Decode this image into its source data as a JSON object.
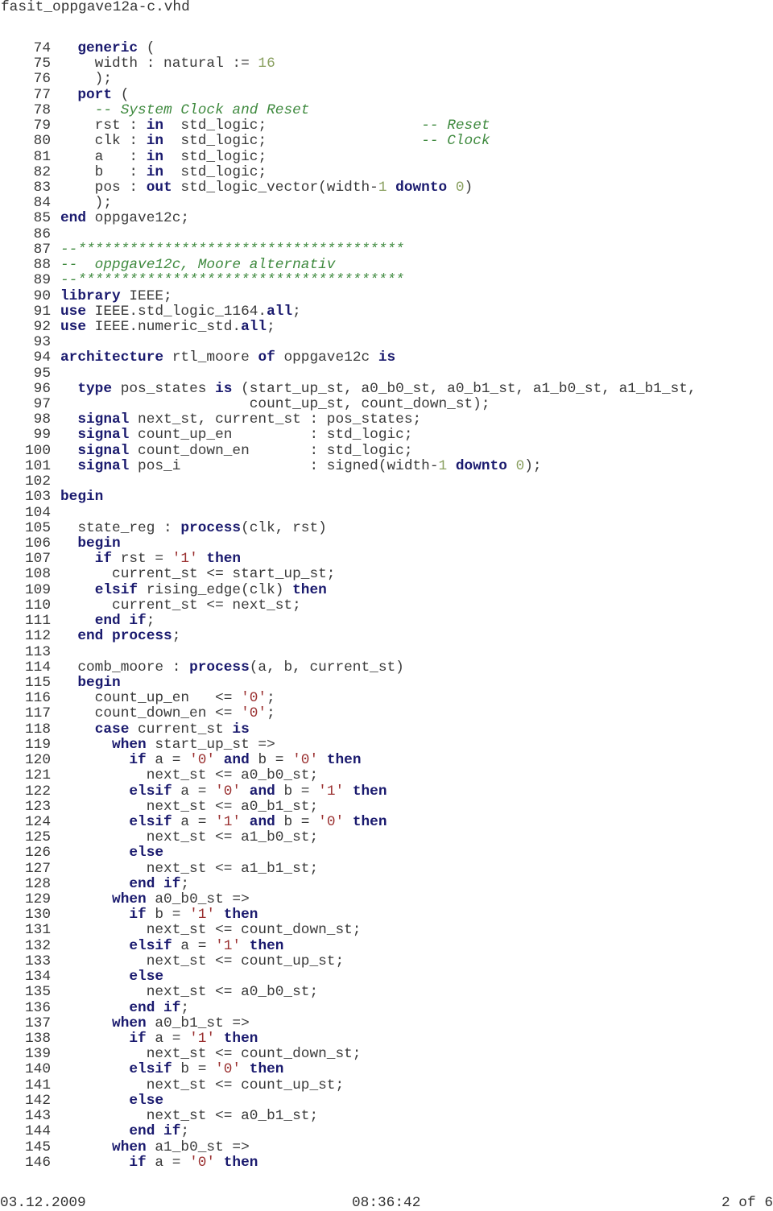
{
  "document": {
    "file_name": "fasit_oppgave12a-c.vhd",
    "footer": {
      "date": "03.12.2009",
      "time": "08:36:42",
      "page": "2 of 6"
    },
    "colors": {
      "keyword": "#1a1a6e",
      "comment": "#3f8a3f",
      "number": "#8aa060",
      "string": "#9a3030",
      "text": "#3a3a3a"
    },
    "lines": [
      {
        "n": "74",
        "t": [
          [
            "p",
            "  "
          ],
          [
            "kw",
            "generic"
          ],
          [
            "p",
            " ("
          ]
        ]
      },
      {
        "n": "75",
        "t": [
          [
            "p",
            "    width : natural := "
          ],
          [
            "num",
            "16"
          ]
        ]
      },
      {
        "n": "76",
        "t": [
          [
            "p",
            "    );"
          ]
        ]
      },
      {
        "n": "77",
        "t": [
          [
            "p",
            "  "
          ],
          [
            "kw",
            "port"
          ],
          [
            "p",
            " ("
          ]
        ]
      },
      {
        "n": "78",
        "t": [
          [
            "p",
            "    "
          ],
          [
            "cm",
            "-- System Clock and Reset"
          ]
        ]
      },
      {
        "n": "79",
        "t": [
          [
            "p",
            "    rst : "
          ],
          [
            "kw",
            "in"
          ],
          [
            "p",
            "  std_logic;                  "
          ],
          [
            "cm",
            "-- Reset"
          ]
        ]
      },
      {
        "n": "80",
        "t": [
          [
            "p",
            "    clk : "
          ],
          [
            "kw",
            "in"
          ],
          [
            "p",
            "  std_logic;                  "
          ],
          [
            "cm",
            "-- Clock"
          ]
        ]
      },
      {
        "n": "81",
        "t": [
          [
            "p",
            "    a   : "
          ],
          [
            "kw",
            "in"
          ],
          [
            "p",
            "  std_logic;"
          ]
        ]
      },
      {
        "n": "82",
        "t": [
          [
            "p",
            "    b   : "
          ],
          [
            "kw",
            "in"
          ],
          [
            "p",
            "  std_logic;"
          ]
        ]
      },
      {
        "n": "83",
        "t": [
          [
            "p",
            "    pos : "
          ],
          [
            "kw",
            "out"
          ],
          [
            "p",
            " std_logic_vector(width-"
          ],
          [
            "num",
            "1"
          ],
          [
            "p",
            " "
          ],
          [
            "kw",
            "downto"
          ],
          [
            "p",
            " "
          ],
          [
            "num",
            "0"
          ],
          [
            "p",
            ")"
          ]
        ]
      },
      {
        "n": "84",
        "t": [
          [
            "p",
            "    );"
          ]
        ]
      },
      {
        "n": "85",
        "t": [
          [
            "kw",
            "end"
          ],
          [
            "p",
            " oppgave12c;"
          ]
        ]
      },
      {
        "n": "86",
        "t": []
      },
      {
        "n": "87",
        "t": [
          [
            "cm",
            "--**************************************"
          ]
        ]
      },
      {
        "n": "88",
        "t": [
          [
            "cm",
            "--  oppgave12c, Moore alternativ"
          ]
        ]
      },
      {
        "n": "89",
        "t": [
          [
            "cm",
            "--**************************************"
          ]
        ]
      },
      {
        "n": "90",
        "t": [
          [
            "kw",
            "library"
          ],
          [
            "p",
            " IEEE;"
          ]
        ]
      },
      {
        "n": "91",
        "t": [
          [
            "kw",
            "use"
          ],
          [
            "p",
            " IEEE.std_logic_1164."
          ],
          [
            "kw",
            "all"
          ],
          [
            "p",
            ";"
          ]
        ]
      },
      {
        "n": "92",
        "t": [
          [
            "kw",
            "use"
          ],
          [
            "p",
            " IEEE.numeric_std."
          ],
          [
            "kw",
            "all"
          ],
          [
            "p",
            ";"
          ]
        ]
      },
      {
        "n": "93",
        "t": []
      },
      {
        "n": "94",
        "t": [
          [
            "kw",
            "architecture"
          ],
          [
            "p",
            " rtl_moore "
          ],
          [
            "kw",
            "of"
          ],
          [
            "p",
            " oppgave12c "
          ],
          [
            "kw",
            "is"
          ]
        ]
      },
      {
        "n": "95",
        "t": []
      },
      {
        "n": "96",
        "t": [
          [
            "p",
            "  "
          ],
          [
            "kw",
            "type"
          ],
          [
            "p",
            " pos_states "
          ],
          [
            "kw",
            "is"
          ],
          [
            "p",
            " (start_up_st, a0_b0_st, a0_b1_st, a1_b0_st, a1_b1_st,"
          ]
        ]
      },
      {
        "n": "97",
        "t": [
          [
            "p",
            "                      count_up_st, count_down_st);"
          ]
        ]
      },
      {
        "n": "98",
        "t": [
          [
            "p",
            "  "
          ],
          [
            "kw",
            "signal"
          ],
          [
            "p",
            " next_st, current_st : pos_states;"
          ]
        ]
      },
      {
        "n": "99",
        "t": [
          [
            "p",
            "  "
          ],
          [
            "kw",
            "signal"
          ],
          [
            "p",
            " count_up_en         : std_logic;"
          ]
        ]
      },
      {
        "n": "100",
        "t": [
          [
            "p",
            "  "
          ],
          [
            "kw",
            "signal"
          ],
          [
            "p",
            " count_down_en       : std_logic;"
          ]
        ]
      },
      {
        "n": "101",
        "t": [
          [
            "p",
            "  "
          ],
          [
            "kw",
            "signal"
          ],
          [
            "p",
            " pos_i               : signed(width-"
          ],
          [
            "num",
            "1"
          ],
          [
            "p",
            " "
          ],
          [
            "kw",
            "downto"
          ],
          [
            "p",
            " "
          ],
          [
            "num",
            "0"
          ],
          [
            "p",
            ");"
          ]
        ]
      },
      {
        "n": "102",
        "t": []
      },
      {
        "n": "103",
        "t": [
          [
            "kw",
            "begin"
          ]
        ]
      },
      {
        "n": "104",
        "t": []
      },
      {
        "n": "105",
        "t": [
          [
            "p",
            "  state_reg : "
          ],
          [
            "kw",
            "process"
          ],
          [
            "p",
            "(clk, rst)"
          ]
        ]
      },
      {
        "n": "106",
        "t": [
          [
            "p",
            "  "
          ],
          [
            "kw",
            "begin"
          ]
        ]
      },
      {
        "n": "107",
        "t": [
          [
            "p",
            "    "
          ],
          [
            "kw",
            "if"
          ],
          [
            "p",
            " rst = "
          ],
          [
            "str",
            "'1'"
          ],
          [
            "p",
            " "
          ],
          [
            "kw",
            "then"
          ]
        ]
      },
      {
        "n": "108",
        "t": [
          [
            "p",
            "      current_st <= start_up_st;"
          ]
        ]
      },
      {
        "n": "109",
        "t": [
          [
            "p",
            "    "
          ],
          [
            "kw",
            "elsif"
          ],
          [
            "p",
            " rising_edge(clk) "
          ],
          [
            "kw",
            "then"
          ]
        ]
      },
      {
        "n": "110",
        "t": [
          [
            "p",
            "      current_st <= next_st;"
          ]
        ]
      },
      {
        "n": "111",
        "t": [
          [
            "p",
            "    "
          ],
          [
            "kw",
            "end if"
          ],
          [
            "p",
            ";"
          ]
        ]
      },
      {
        "n": "112",
        "t": [
          [
            "p",
            "  "
          ],
          [
            "kw",
            "end process"
          ],
          [
            "p",
            ";"
          ]
        ]
      },
      {
        "n": "113",
        "t": []
      },
      {
        "n": "114",
        "t": [
          [
            "p",
            "  comb_moore : "
          ],
          [
            "kw",
            "process"
          ],
          [
            "p",
            "(a, b, current_st)"
          ]
        ]
      },
      {
        "n": "115",
        "t": [
          [
            "p",
            "  "
          ],
          [
            "kw",
            "begin"
          ]
        ]
      },
      {
        "n": "116",
        "t": [
          [
            "p",
            "    count_up_en   <= "
          ],
          [
            "str",
            "'0'"
          ],
          [
            "p",
            ";"
          ]
        ]
      },
      {
        "n": "117",
        "t": [
          [
            "p",
            "    count_down_en <= "
          ],
          [
            "str",
            "'0'"
          ],
          [
            "p",
            ";"
          ]
        ]
      },
      {
        "n": "118",
        "t": [
          [
            "p",
            "    "
          ],
          [
            "kw",
            "case"
          ],
          [
            "p",
            " current_st "
          ],
          [
            "kw",
            "is"
          ]
        ]
      },
      {
        "n": "119",
        "t": [
          [
            "p",
            "      "
          ],
          [
            "kw",
            "when"
          ],
          [
            "p",
            " start_up_st =>"
          ]
        ]
      },
      {
        "n": "120",
        "t": [
          [
            "p",
            "        "
          ],
          [
            "kw",
            "if"
          ],
          [
            "p",
            " a = "
          ],
          [
            "str",
            "'0'"
          ],
          [
            "p",
            " "
          ],
          [
            "kw",
            "and"
          ],
          [
            "p",
            " b = "
          ],
          [
            "str",
            "'0'"
          ],
          [
            "p",
            " "
          ],
          [
            "kw",
            "then"
          ]
        ]
      },
      {
        "n": "121",
        "t": [
          [
            "p",
            "          next_st <= a0_b0_st;"
          ]
        ]
      },
      {
        "n": "122",
        "t": [
          [
            "p",
            "        "
          ],
          [
            "kw",
            "elsif"
          ],
          [
            "p",
            " a = "
          ],
          [
            "str",
            "'0'"
          ],
          [
            "p",
            " "
          ],
          [
            "kw",
            "and"
          ],
          [
            "p",
            " b = "
          ],
          [
            "str",
            "'1'"
          ],
          [
            "p",
            " "
          ],
          [
            "kw",
            "then"
          ]
        ]
      },
      {
        "n": "123",
        "t": [
          [
            "p",
            "          next_st <= a0_b1_st;"
          ]
        ]
      },
      {
        "n": "124",
        "t": [
          [
            "p",
            "        "
          ],
          [
            "kw",
            "elsif"
          ],
          [
            "p",
            " a = "
          ],
          [
            "str",
            "'1'"
          ],
          [
            "p",
            " "
          ],
          [
            "kw",
            "and"
          ],
          [
            "p",
            " b = "
          ],
          [
            "str",
            "'0'"
          ],
          [
            "p",
            " "
          ],
          [
            "kw",
            "then"
          ]
        ]
      },
      {
        "n": "125",
        "t": [
          [
            "p",
            "          next_st <= a1_b0_st;"
          ]
        ]
      },
      {
        "n": "126",
        "t": [
          [
            "p",
            "        "
          ],
          [
            "kw",
            "else"
          ]
        ]
      },
      {
        "n": "127",
        "t": [
          [
            "p",
            "          next_st <= a1_b1_st;"
          ]
        ]
      },
      {
        "n": "128",
        "t": [
          [
            "p",
            "        "
          ],
          [
            "kw",
            "end if"
          ],
          [
            "p",
            ";"
          ]
        ]
      },
      {
        "n": "129",
        "t": [
          [
            "p",
            "      "
          ],
          [
            "kw",
            "when"
          ],
          [
            "p",
            " a0_b0_st =>"
          ]
        ]
      },
      {
        "n": "130",
        "t": [
          [
            "p",
            "        "
          ],
          [
            "kw",
            "if"
          ],
          [
            "p",
            " b = "
          ],
          [
            "str",
            "'1'"
          ],
          [
            "p",
            " "
          ],
          [
            "kw",
            "then"
          ]
        ]
      },
      {
        "n": "131",
        "t": [
          [
            "p",
            "          next_st <= count_down_st;"
          ]
        ]
      },
      {
        "n": "132",
        "t": [
          [
            "p",
            "        "
          ],
          [
            "kw",
            "elsif"
          ],
          [
            "p",
            " a = "
          ],
          [
            "str",
            "'1'"
          ],
          [
            "p",
            " "
          ],
          [
            "kw",
            "then"
          ]
        ]
      },
      {
        "n": "133",
        "t": [
          [
            "p",
            "          next_st <= count_up_st;"
          ]
        ]
      },
      {
        "n": "134",
        "t": [
          [
            "p",
            "        "
          ],
          [
            "kw",
            "else"
          ]
        ]
      },
      {
        "n": "135",
        "t": [
          [
            "p",
            "          next_st <= a0_b0_st;"
          ]
        ]
      },
      {
        "n": "136",
        "t": [
          [
            "p",
            "        "
          ],
          [
            "kw",
            "end if"
          ],
          [
            "p",
            ";"
          ]
        ]
      },
      {
        "n": "137",
        "t": [
          [
            "p",
            "      "
          ],
          [
            "kw",
            "when"
          ],
          [
            "p",
            " a0_b1_st =>"
          ]
        ]
      },
      {
        "n": "138",
        "t": [
          [
            "p",
            "        "
          ],
          [
            "kw",
            "if"
          ],
          [
            "p",
            " a = "
          ],
          [
            "str",
            "'1'"
          ],
          [
            "p",
            " "
          ],
          [
            "kw",
            "then"
          ]
        ]
      },
      {
        "n": "139",
        "t": [
          [
            "p",
            "          next_st <= count_down_st;"
          ]
        ]
      },
      {
        "n": "140",
        "t": [
          [
            "p",
            "        "
          ],
          [
            "kw",
            "elsif"
          ],
          [
            "p",
            " b = "
          ],
          [
            "str",
            "'0'"
          ],
          [
            "p",
            " "
          ],
          [
            "kw",
            "then"
          ]
        ]
      },
      {
        "n": "141",
        "t": [
          [
            "p",
            "          next_st <= count_up_st;"
          ]
        ]
      },
      {
        "n": "142",
        "t": [
          [
            "p",
            "        "
          ],
          [
            "kw",
            "else"
          ]
        ]
      },
      {
        "n": "143",
        "t": [
          [
            "p",
            "          next_st <= a0_b1_st;"
          ]
        ]
      },
      {
        "n": "144",
        "t": [
          [
            "p",
            "        "
          ],
          [
            "kw",
            "end if"
          ],
          [
            "p",
            ";"
          ]
        ]
      },
      {
        "n": "145",
        "t": [
          [
            "p",
            "      "
          ],
          [
            "kw",
            "when"
          ],
          [
            "p",
            " a1_b0_st =>"
          ]
        ]
      },
      {
        "n": "146",
        "t": [
          [
            "p",
            "        "
          ],
          [
            "kw",
            "if"
          ],
          [
            "p",
            " a = "
          ],
          [
            "str",
            "'0'"
          ],
          [
            "p",
            " "
          ],
          [
            "kw",
            "then"
          ]
        ]
      }
    ]
  }
}
